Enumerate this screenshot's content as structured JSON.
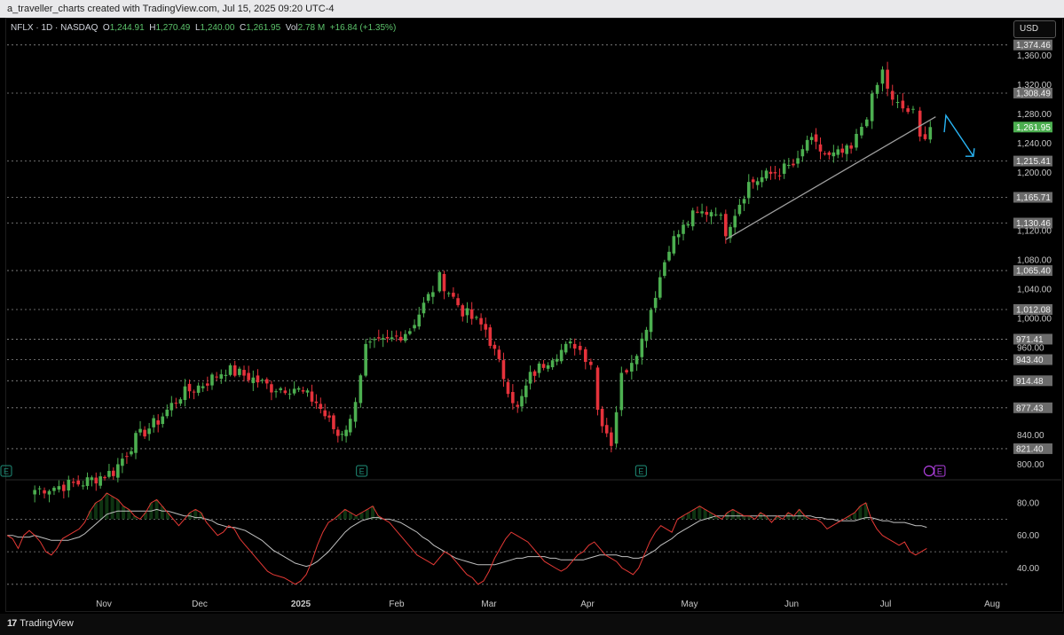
{
  "header": {
    "attribution": "a_traveller_charts created with TradingView.com, Jul 15, 2025 09:20 UTC-4"
  },
  "legend": {
    "symbol": "NFLX · 1D · NASDAQ",
    "open_label": "O",
    "open": "1,244.91",
    "high_label": "H",
    "high": "1,270.49",
    "low_label": "L",
    "low": "1,240.00",
    "close_label": "C",
    "close": "1,261.95",
    "vol_label": "Vol",
    "vol": "2.78 M",
    "change": "+16.84 (+1.35%)"
  },
  "currency_button": "USD",
  "footer": {
    "brand": "TradingView"
  },
  "colors": {
    "up": "#4caf50",
    "down": "#e5323b",
    "rsi": "#e53935",
    "rsi_ma": "#c0c0c0",
    "arrow": "#29b6f6",
    "trendline": "#9e9e9e",
    "current_price": "#4caf50"
  },
  "chart_data": [
    {
      "type": "candlestick",
      "symbol": "NFLX",
      "timeframe": "1D",
      "ylim": [
        780,
        1385
      ],
      "y_ticks": [
        800,
        840,
        960,
        1000,
        1040,
        1080,
        1120,
        1200,
        1240,
        1280,
        1320,
        1360
      ],
      "y_tick_labels": [
        "800.00",
        "840.00",
        "960.00",
        "1,000.00",
        "1,040.00",
        "1,080.00",
        "1,120.00",
        "1,200.00",
        "1,240.00",
        "1,280.00",
        "1,320.00",
        "1,360.00"
      ],
      "levels": [
        1374.46,
        1308.49,
        1215.41,
        1165.71,
        1130.46,
        1065.4,
        1012.08,
        971.41,
        943.4,
        914.48,
        877.43,
        821.4
      ],
      "level_labels": [
        "1,374.46",
        "1,308.49",
        "1,215.41",
        "1,165.71",
        "1,130.46",
        "1,065.40",
        "1,012.08",
        "971.41",
        "943.40",
        "914.48",
        "877.43",
        "821.40"
      ],
      "current_price": 1261.95,
      "current_price_label": "1,261.95",
      "x_ticks": [
        "Nov",
        "Dec",
        "2025",
        "Feb",
        "Mar",
        "Apr",
        "May",
        "Jun",
        "Jul",
        "Aug"
      ],
      "earnings_markers": [
        {
          "label": "E",
          "date": "Oct 17"
        },
        {
          "label": "E",
          "date": "Jan 21"
        },
        {
          "label": "E",
          "date": "Apr 17"
        },
        {
          "label": "E",
          "date": "Jul 17"
        }
      ],
      "trendline": {
        "from": {
          "date": "May 12",
          "price": 1108
        },
        "to": {
          "date": "Jul 14",
          "price": 1276
        }
      },
      "projection_arrow": {
        "from": {
          "date": "Jul 16",
          "price": 1255
        },
        "via": {
          "date": "Jul 17",
          "price": 1278
        },
        "to": {
          "date": "Jul 25",
          "price": 1222
        }
      },
      "key_closes": [
        {
          "date": "Oct 21",
          "close": 765
        },
        {
          "date": "Oct 28",
          "close": 775
        },
        {
          "date": "Nov 4",
          "close": 790
        },
        {
          "date": "Nov 11",
          "close": 835
        },
        {
          "date": "Nov 18",
          "close": 860
        },
        {
          "date": "Nov 25",
          "close": 895
        },
        {
          "date": "Dec 2",
          "close": 910
        },
        {
          "date": "Dec 9",
          "close": 930
        },
        {
          "date": "Dec 16",
          "close": 920
        },
        {
          "date": "Dec 23",
          "close": 905
        },
        {
          "date": "Dec 30",
          "close": 905
        },
        {
          "date": "Jan 6",
          "close": 885
        },
        {
          "date": "Jan 13",
          "close": 840
        },
        {
          "date": "Jan 17",
          "close": 858
        },
        {
          "date": "Jan 22",
          "close": 960
        },
        {
          "date": "Jan 29",
          "close": 968
        },
        {
          "date": "Feb 5",
          "close": 985
        },
        {
          "date": "Feb 12",
          "close": 1040
        },
        {
          "date": "Feb 14",
          "close": 1055
        },
        {
          "date": "Feb 21",
          "close": 1010
        },
        {
          "date": "Feb 28",
          "close": 985
        },
        {
          "date": "Mar 7",
          "close": 905
        },
        {
          "date": "Mar 10",
          "close": 875
        },
        {
          "date": "Mar 14",
          "close": 920
        },
        {
          "date": "Mar 21",
          "close": 950
        },
        {
          "date": "Mar 28",
          "close": 965
        },
        {
          "date": "Apr 2",
          "close": 940
        },
        {
          "date": "Apr 4",
          "close": 875
        },
        {
          "date": "Apr 8",
          "close": 830
        },
        {
          "date": "Apr 11",
          "close": 920
        },
        {
          "date": "Apr 17",
          "close": 970
        },
        {
          "date": "Apr 25",
          "close": 1100
        },
        {
          "date": "May 2",
          "close": 1140
        },
        {
          "date": "May 9",
          "close": 1150
        },
        {
          "date": "May 12",
          "close": 1120
        },
        {
          "date": "May 19",
          "close": 1185
        },
        {
          "date": "May 27",
          "close": 1200
        },
        {
          "date": "Jun 3",
          "close": 1212
        },
        {
          "date": "Jun 6",
          "close": 1245
        },
        {
          "date": "Jun 13",
          "close": 1220
        },
        {
          "date": "Jun 20",
          "close": 1230
        },
        {
          "date": "Jun 25",
          "close": 1280
        },
        {
          "date": "Jun 30",
          "close": 1338
        },
        {
          "date": "Jul 3",
          "close": 1295
        },
        {
          "date": "Jul 9",
          "close": 1280
        },
        {
          "date": "Jul 11",
          "close": 1245
        },
        {
          "date": "Jul 14",
          "close": 1261.95
        }
      ]
    },
    {
      "type": "line",
      "indicator": "RSI",
      "ylim": [
        25,
        92
      ],
      "y_ticks": [
        40,
        60,
        80
      ],
      "y_tick_labels": [
        "40.00",
        "60.00",
        "80.00"
      ],
      "bands": [
        70,
        50,
        30
      ],
      "series": [
        {
          "values": [
            60,
            58,
            52,
            60,
            63,
            60,
            56,
            50,
            48,
            52,
            58,
            60,
            62,
            64,
            68,
            75,
            80,
            82,
            86,
            84,
            82,
            78,
            76,
            72,
            70,
            74,
            80,
            82,
            78,
            74,
            70,
            66,
            70,
            74,
            76,
            74,
            68,
            64,
            60,
            62,
            66,
            64,
            58,
            54,
            50,
            46,
            42,
            38,
            36,
            35,
            34,
            32,
            30,
            32,
            36,
            44,
            54,
            62,
            68,
            70,
            73,
            76,
            74,
            72,
            74,
            76,
            78,
            72,
            70,
            68,
            64,
            60,
            56,
            52,
            48,
            46,
            44,
            42,
            46,
            50,
            48,
            44,
            40,
            36,
            34,
            30,
            32,
            38,
            46,
            52,
            58,
            62,
            60,
            58,
            56,
            52,
            48,
            44,
            42,
            40,
            38,
            40,
            44,
            48,
            50,
            54,
            56,
            52,
            48,
            46,
            44,
            40,
            38,
            36,
            40,
            48,
            56,
            62,
            66,
            64,
            62,
            70,
            72,
            74,
            76,
            78,
            76,
            74,
            72,
            70,
            74,
            76,
            74,
            72,
            72,
            70,
            74,
            72,
            68,
            72,
            70,
            74,
            72,
            76,
            72,
            70,
            70,
            68,
            64,
            66,
            68,
            70,
            72,
            74,
            78,
            80,
            70,
            64,
            60,
            58,
            56,
            54,
            56,
            50,
            48,
            50,
            52
          ]
        },
        {
          "values": [
            60,
            60,
            59,
            59,
            59,
            60,
            59,
            58,
            57,
            57,
            57,
            57,
            58,
            59,
            61,
            64,
            67,
            70,
            73,
            74,
            75,
            75,
            75,
            75,
            75,
            75,
            75,
            76,
            75,
            75,
            74,
            73,
            72,
            72,
            71,
            71,
            70,
            69,
            67,
            66,
            65,
            65,
            64,
            63,
            61,
            59,
            57,
            54,
            51,
            49,
            47,
            45,
            43,
            42,
            41,
            42,
            44,
            47,
            50,
            54,
            58,
            62,
            65,
            67,
            69,
            70,
            71,
            71,
            70,
            70,
            69,
            68,
            66,
            64,
            62,
            59,
            57,
            54,
            52,
            50,
            48,
            46,
            45,
            44,
            43,
            42,
            42,
            42,
            42,
            43,
            44,
            45,
            46,
            46,
            47,
            47,
            47,
            47,
            46,
            46,
            45,
            45,
            45,
            45,
            45,
            46,
            47,
            48,
            48,
            48,
            48,
            47,
            47,
            46,
            46,
            47,
            49,
            51,
            54,
            56,
            58,
            61,
            63,
            65,
            67,
            69,
            70,
            71,
            72,
            72,
            72,
            72,
            72,
            72,
            72,
            72,
            72,
            72,
            72,
            72,
            72,
            72,
            72,
            72,
            72,
            72,
            71,
            71,
            70,
            70,
            69,
            69,
            69,
            69,
            70,
            71,
            71,
            70,
            69,
            69,
            68,
            68,
            68,
            67,
            66,
            66,
            65
          ]
        }
      ]
    }
  ]
}
